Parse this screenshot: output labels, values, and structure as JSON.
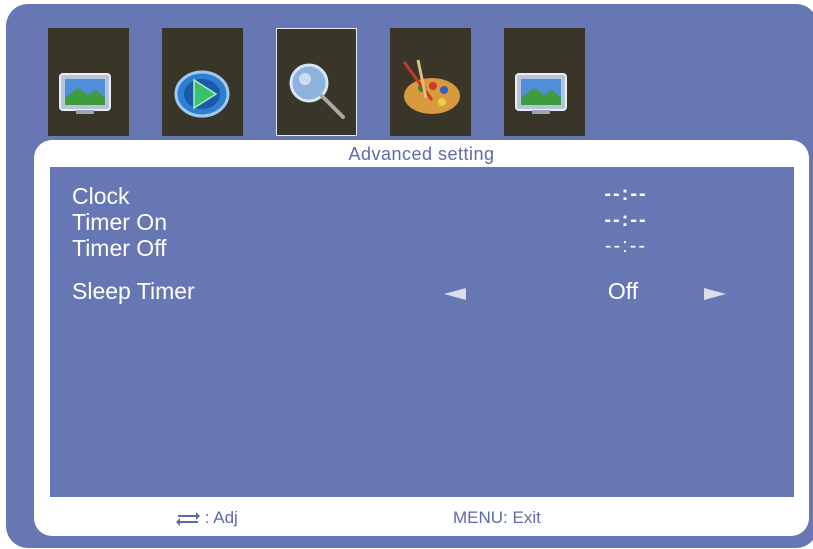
{
  "tabs": [
    {
      "icon": "monitor-picture-icon",
      "selected": false
    },
    {
      "icon": "play-sphere-icon",
      "selected": false
    },
    {
      "icon": "magnifier-icon",
      "selected": true
    },
    {
      "icon": "palette-icon",
      "selected": false
    },
    {
      "icon": "monitor-picture-icon",
      "selected": false
    }
  ],
  "menu": {
    "title": "Advanced setting",
    "rows": [
      {
        "label": "Clock",
        "value": "--:--"
      },
      {
        "label": "Timer On",
        "value": "--:--"
      },
      {
        "label": "Timer Off",
        "value": "--:--"
      },
      {
        "label": "Sleep Timer",
        "value": "Off"
      }
    ]
  },
  "footer": {
    "adjust_hint": ": Adj",
    "exit_hint": "MENU: Exit"
  },
  "colors": {
    "panel": "#6677b3",
    "card": "#ffffff",
    "tab_bg": "#3a3529",
    "accent_text": "#5d6aa9"
  }
}
